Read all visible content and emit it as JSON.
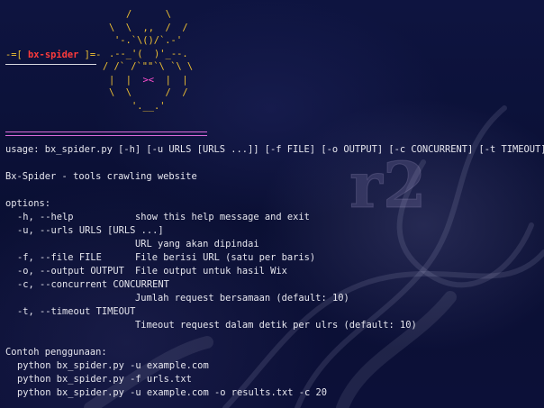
{
  "banner": {
    "bracket_left": "-=[",
    "name": "bx-spider",
    "bracket_right": "]=-"
  },
  "spider_art": {
    "line1": "/      \\",
    "line2": "\\  \\  ,,  /  /",
    "line3": "'-.`\\()/`.-'",
    "line4": ".--_'(  )'_--.",
    "line5": "/ /` /`\"\"`\\ `\\ \\",
    "line6_left": "|  |  ",
    "line6_eye": "><",
    "line6_right": "  |  |",
    "line7": "\\  \\      /  /",
    "line8": "'.__.'"
  },
  "help": {
    "usage": "usage: bx_spider.py [-h] [-u URLS [URLS ...]] [-f FILE] [-o OUTPUT] [-c CONCURRENT] [-t TIMEOUT]",
    "description": "Bx-Spider - tools crawling website",
    "options_header": "options:",
    "options": [
      {
        "flag": "-h, --help",
        "desc": "show this help message and exit"
      },
      {
        "flag": "-u, --urls URLS [URLS ...]",
        "desc": "URL yang akan dipindai"
      },
      {
        "flag": "-f, --file FILE",
        "desc": "File berisi URL (satu per baris)"
      },
      {
        "flag": "-o, --output OUTPUT",
        "desc": "File output untuk hasil Wix"
      },
      {
        "flag": "-c, --concurrent CONCURRENT",
        "desc": "Jumlah request bersamaan (default: 10)"
      },
      {
        "flag": "-t, --timeout TIMEOUT",
        "desc": "Timeout request dalam detik per ulrs (default: 10)"
      }
    ],
    "examples_header": "Contoh penggunaan:",
    "examples": [
      "python bx_spider.py -u example.com",
      "python bx_spider.py -f urls.txt",
      "python bx_spider.py -u example.com -o results.txt -c 20"
    ]
  }
}
